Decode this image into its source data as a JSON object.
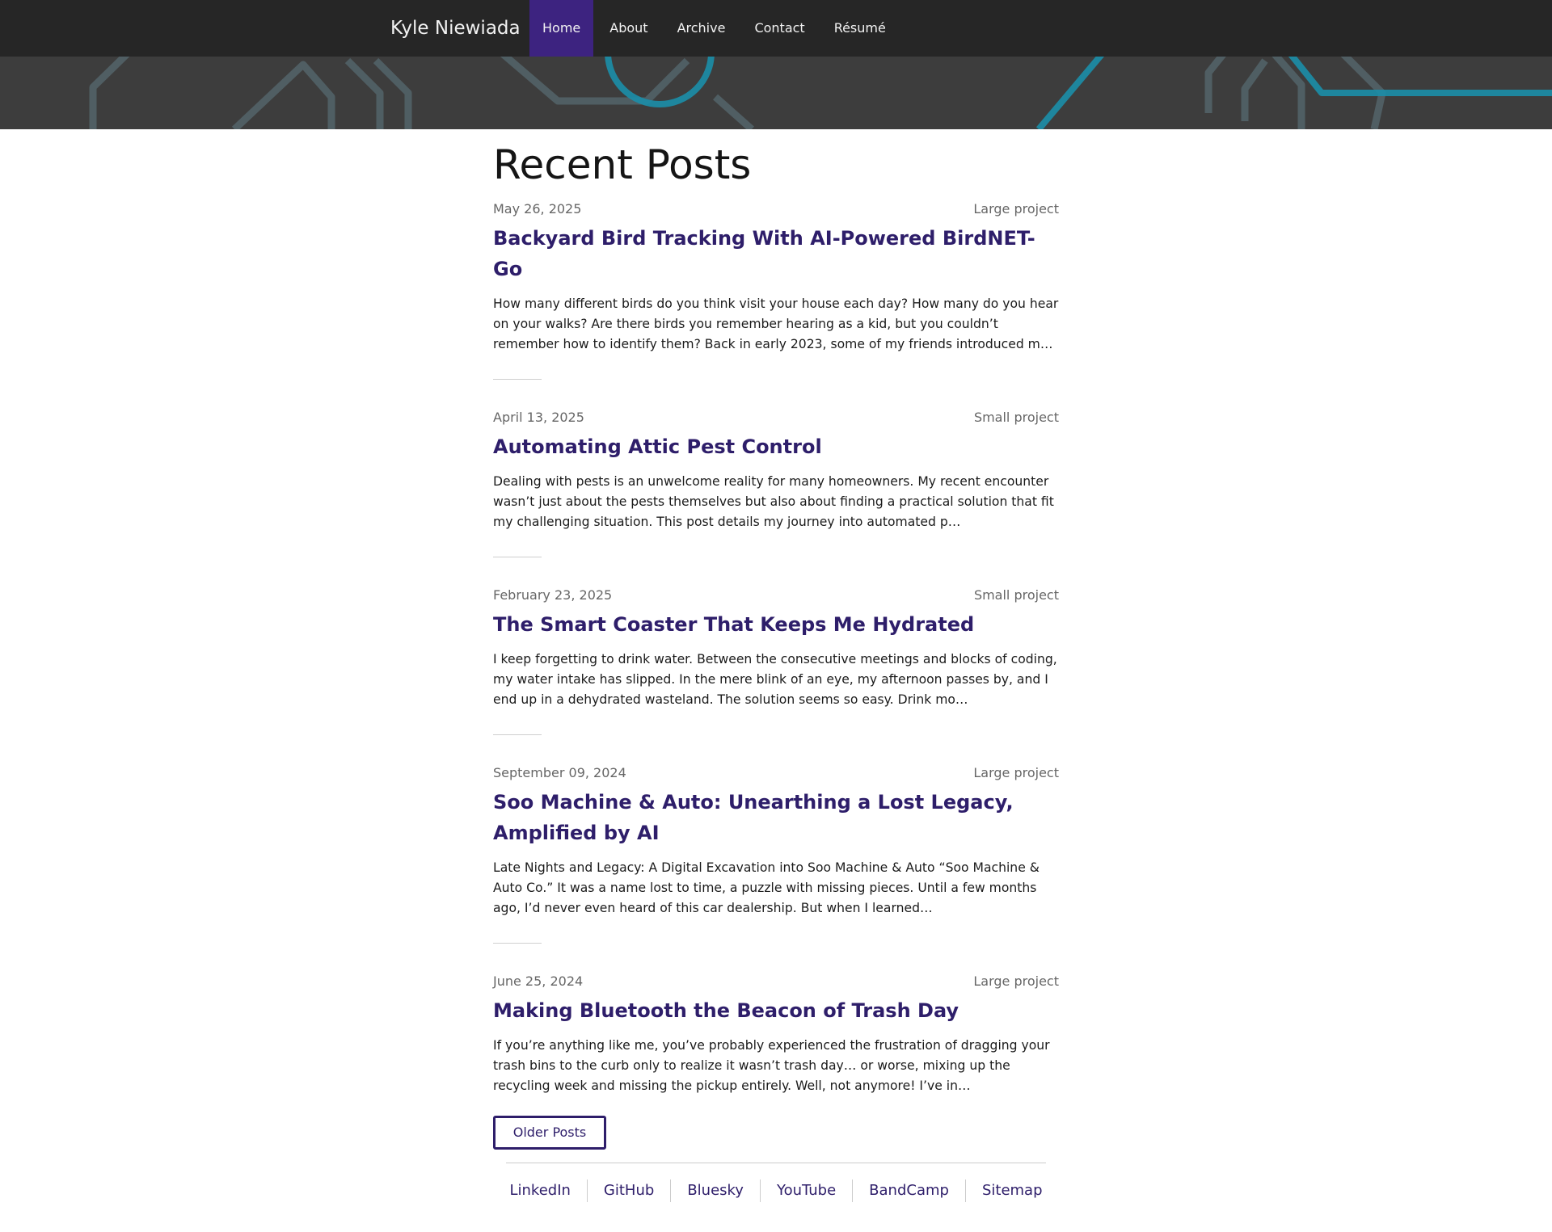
{
  "nav": {
    "brand": "Kyle Niewiada",
    "items": [
      {
        "label": "Home",
        "active": true
      },
      {
        "label": "About",
        "active": false
      },
      {
        "label": "Archive",
        "active": false
      },
      {
        "label": "Contact",
        "active": false
      },
      {
        "label": "Résumé",
        "active": false
      }
    ]
  },
  "main": {
    "title": "Recent Posts",
    "posts": [
      {
        "date": "May 26, 2025",
        "category": "Large project",
        "title": "Backyard Bird Tracking With AI-Powered BirdNET-Go",
        "excerpt": "How many different birds do you think visit your house each day? How many do you hear on your walks? Are there birds you remember hearing as a kid, but you couldn’t remember how to identify them? Back in early 2023, some of my friends introduced m…"
      },
      {
        "date": "April 13, 2025",
        "category": "Small project",
        "title": "Automating Attic Pest Control",
        "excerpt": "Dealing with pests is an unwelcome reality for many homeowners. My recent encounter wasn’t just about the pests themselves but also about finding a practical solution that fit my challenging situation. This post details my journey into automated p…"
      },
      {
        "date": "February 23, 2025",
        "category": "Small project",
        "title": "The Smart Coaster That Keeps Me Hydrated",
        "excerpt": "I keep forgetting to drink water. Between the consecutive meetings and blocks of coding, my water intake has slipped. In the mere blink of an eye, my afternoon passes by, and I end up in a dehydrated wasteland. The solution seems so easy. Drink mo…"
      },
      {
        "date": "September 09, 2024",
        "category": "Large project",
        "title": "Soo Machine & Auto: Unearthing a Lost Legacy, Amplified by AI",
        "excerpt": "Late Nights and Legacy: A Digital Excavation into Soo Machine & Auto “Soo Machine & Auto Co.” It was a name lost to time, a puzzle with missing pieces. Until a few months ago, I’d never even heard of this car dealership. But when I learned…"
      },
      {
        "date": "June 25, 2024",
        "category": "Large project",
        "title": "Making Bluetooth the Beacon of Trash Day",
        "excerpt": "If you’re anything like me, you’ve probably experienced the frustration of dragging your trash bins to the curb only to realize it wasn’t trash day… or worse, mixing up the recycling week and missing the pickup entirely. Well, not anymore! I’ve in…"
      }
    ],
    "older_label": "Older Posts"
  },
  "footer": {
    "links": [
      "LinkedIn",
      "GitHub",
      "Bluesky",
      "YouTube",
      "BandCamp",
      "Sitemap"
    ]
  },
  "colors": {
    "nav_bg": "#262626",
    "nav_active": "#3d2380",
    "banner_bg": "#3d3d3d",
    "banner_lines": "#55656a",
    "banner_accent": "#1b9ab8",
    "link": "#2e1e6a",
    "meta": "#666666"
  }
}
